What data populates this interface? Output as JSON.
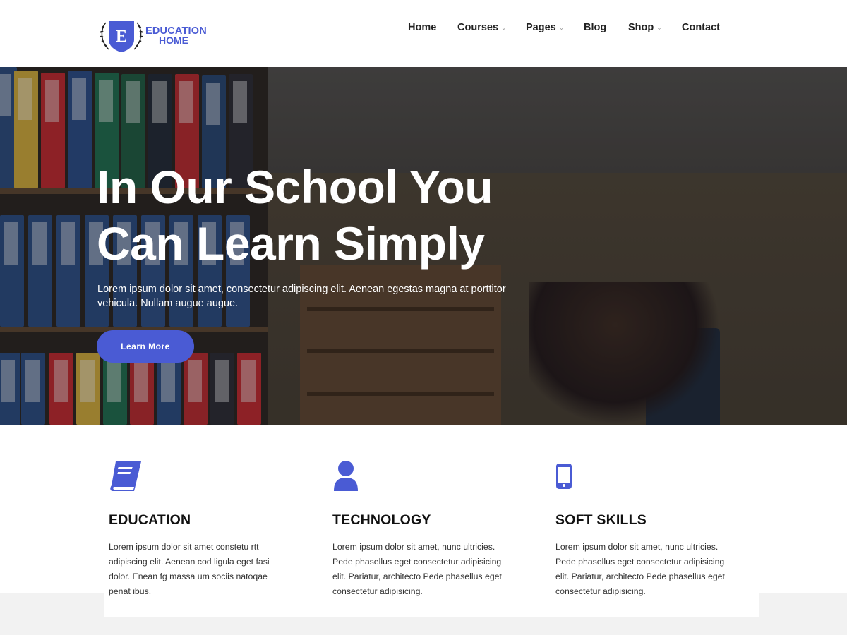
{
  "brand": {
    "badge_letter": "E",
    "line1": "EDUCATION",
    "line2": "HOME",
    "color": "#4a5bd4"
  },
  "nav": {
    "items": [
      {
        "label": "Home",
        "has_dropdown": false
      },
      {
        "label": "Courses",
        "has_dropdown": true
      },
      {
        "label": "Pages",
        "has_dropdown": true
      },
      {
        "label": "Blog",
        "has_dropdown": false
      },
      {
        "label": "Shop",
        "has_dropdown": true
      },
      {
        "label": "Contact",
        "has_dropdown": false
      }
    ],
    "dropdown_glyph": "⌄"
  },
  "hero": {
    "title_line1": "In Our School You",
    "title_line2": "Can Learn Simply",
    "subtitle": "Lorem ipsum dolor sit amet, consectetur adipiscing elit. Aenean egestas magna at porttitor vehicula. Nullam augue augue.",
    "button_label": "Learn More"
  },
  "features": [
    {
      "icon": "book-icon",
      "title": "EDUCATION",
      "text": "Lorem ipsum dolor sit amet constetu rtt adipiscing elit. Aenean cod ligula eget fasi dolor. Enean fg massa um sociis natoqae penat ibus."
    },
    {
      "icon": "user-icon",
      "title": "TECHNOLOGY",
      "text": "Lorem ipsum dolor sit amet, nunc ultricies. Pede phasellus eget consectetur adipisicing elit. Pariatur, architecto Pede phasellus eget consectetur adipisicing."
    },
    {
      "icon": "mobile-phone-icon",
      "title": "SOFT SKILLS",
      "text": "Lorem ipsum dolor sit amet, nunc ultricies. Pede phasellus eget consectetur adipisicing elit. Pariatur, architecto Pede phasellus eget consectetur adipisicing."
    }
  ],
  "colors": {
    "accent": "#4a5bd4",
    "text_dark": "#222222",
    "background_light": "#f2f2f2"
  }
}
